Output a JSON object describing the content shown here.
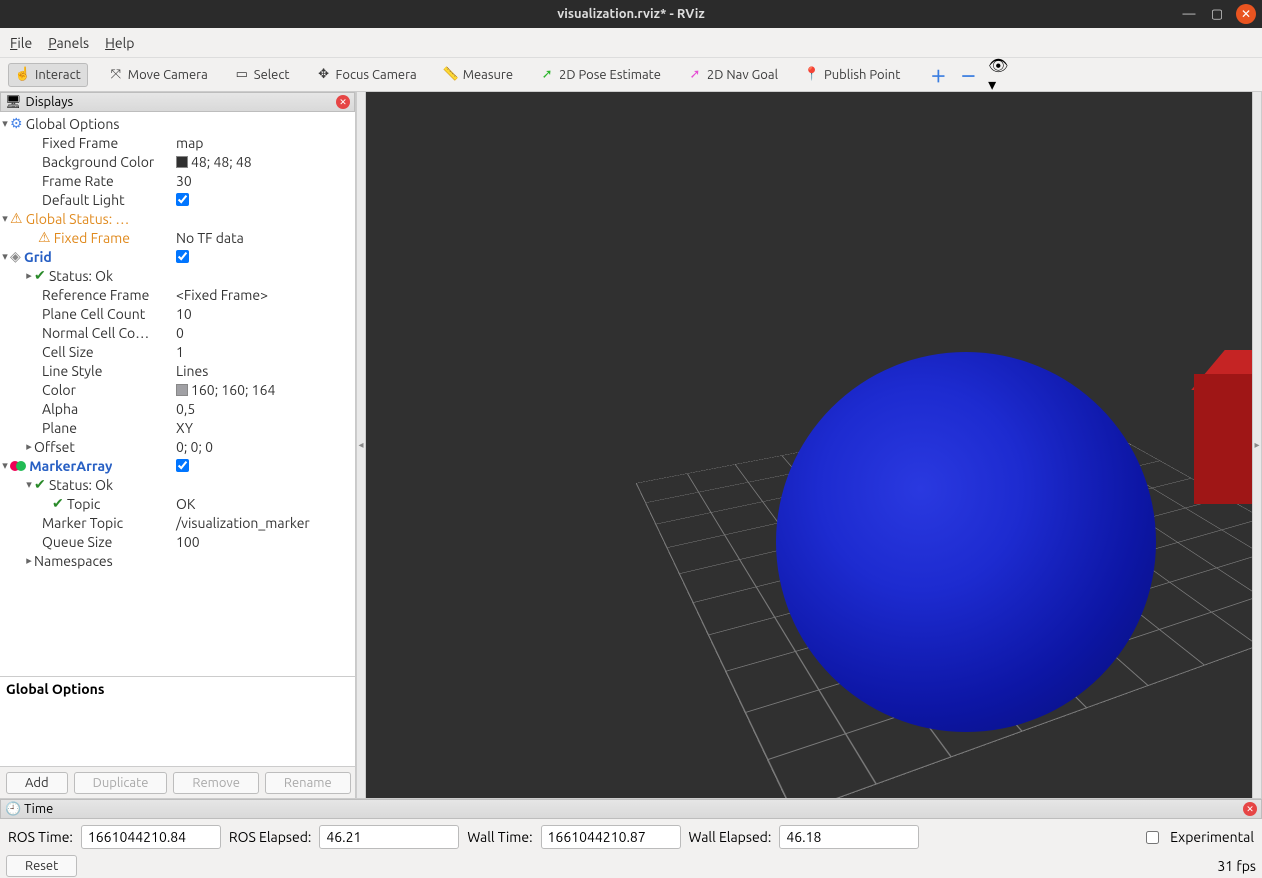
{
  "window": {
    "title": "visualization.rviz* - RViz"
  },
  "menu": {
    "file": "File",
    "panels": "Panels",
    "help": "Help"
  },
  "toolbar": {
    "interact": "Interact",
    "moveCamera": "Move Camera",
    "select": "Select",
    "focusCamera": "Focus Camera",
    "measure": "Measure",
    "pose2d": "2D Pose Estimate",
    "nav2d": "2D Nav Goal",
    "publishPoint": "Publish Point"
  },
  "displaysPanel": {
    "title": "Displays"
  },
  "tree": {
    "globalOptions": {
      "label": "Global Options",
      "fixedFrame": {
        "k": "Fixed Frame",
        "v": "map"
      },
      "bgColor": {
        "k": "Background Color",
        "v": "48; 48; 48",
        "hex": "#303030"
      },
      "frameRate": {
        "k": "Frame Rate",
        "v": "30"
      },
      "defaultLight": {
        "k": "Default Light",
        "checked": true
      }
    },
    "globalStatus": {
      "label": "Global Status: …",
      "fixedFrame": {
        "k": "Fixed Frame",
        "v": "No TF data"
      }
    },
    "grid": {
      "label": "Grid",
      "checked": true,
      "status": {
        "k": "Status: Ok"
      },
      "referenceFrame": {
        "k": "Reference Frame",
        "v": "<Fixed Frame>"
      },
      "planeCellCount": {
        "k": "Plane Cell Count",
        "v": "10"
      },
      "normalCellCount": {
        "k": "Normal Cell Co…",
        "v": "0"
      },
      "cellSize": {
        "k": "Cell Size",
        "v": "1"
      },
      "lineStyle": {
        "k": "Line Style",
        "v": "Lines"
      },
      "color": {
        "k": "Color",
        "v": "160; 160; 164",
        "hex": "#a0a0a4"
      },
      "alpha": {
        "k": "Alpha",
        "v": "0,5"
      },
      "plane": {
        "k": "Plane",
        "v": "XY"
      },
      "offset": {
        "k": "Offset",
        "v": "0; 0; 0"
      }
    },
    "markerArray": {
      "label": "MarkerArray",
      "checked": true,
      "status": {
        "k": "Status: Ok"
      },
      "topic": {
        "k": "Topic",
        "v": "OK"
      },
      "markerTopic": {
        "k": "Marker Topic",
        "v": "/visualization_marker"
      },
      "queueSize": {
        "k": "Queue Size",
        "v": "100"
      },
      "namespaces": {
        "k": "Namespaces"
      }
    }
  },
  "description": {
    "title": "Global Options"
  },
  "buttons": {
    "add": "Add",
    "duplicate": "Duplicate",
    "remove": "Remove",
    "rename": "Rename"
  },
  "timePanel": {
    "title": "Time",
    "rosTimeLabel": "ROS Time:",
    "rosTime": "1661044210.84",
    "rosElapsedLabel": "ROS Elapsed:",
    "rosElapsed": "46.21",
    "wallTimeLabel": "Wall Time:",
    "wallTime": "1661044210.87",
    "wallElapsedLabel": "Wall Elapsed:",
    "wallElapsed": "46.18",
    "experimental": "Experimental",
    "reset": "Reset",
    "fps": "31 fps"
  }
}
